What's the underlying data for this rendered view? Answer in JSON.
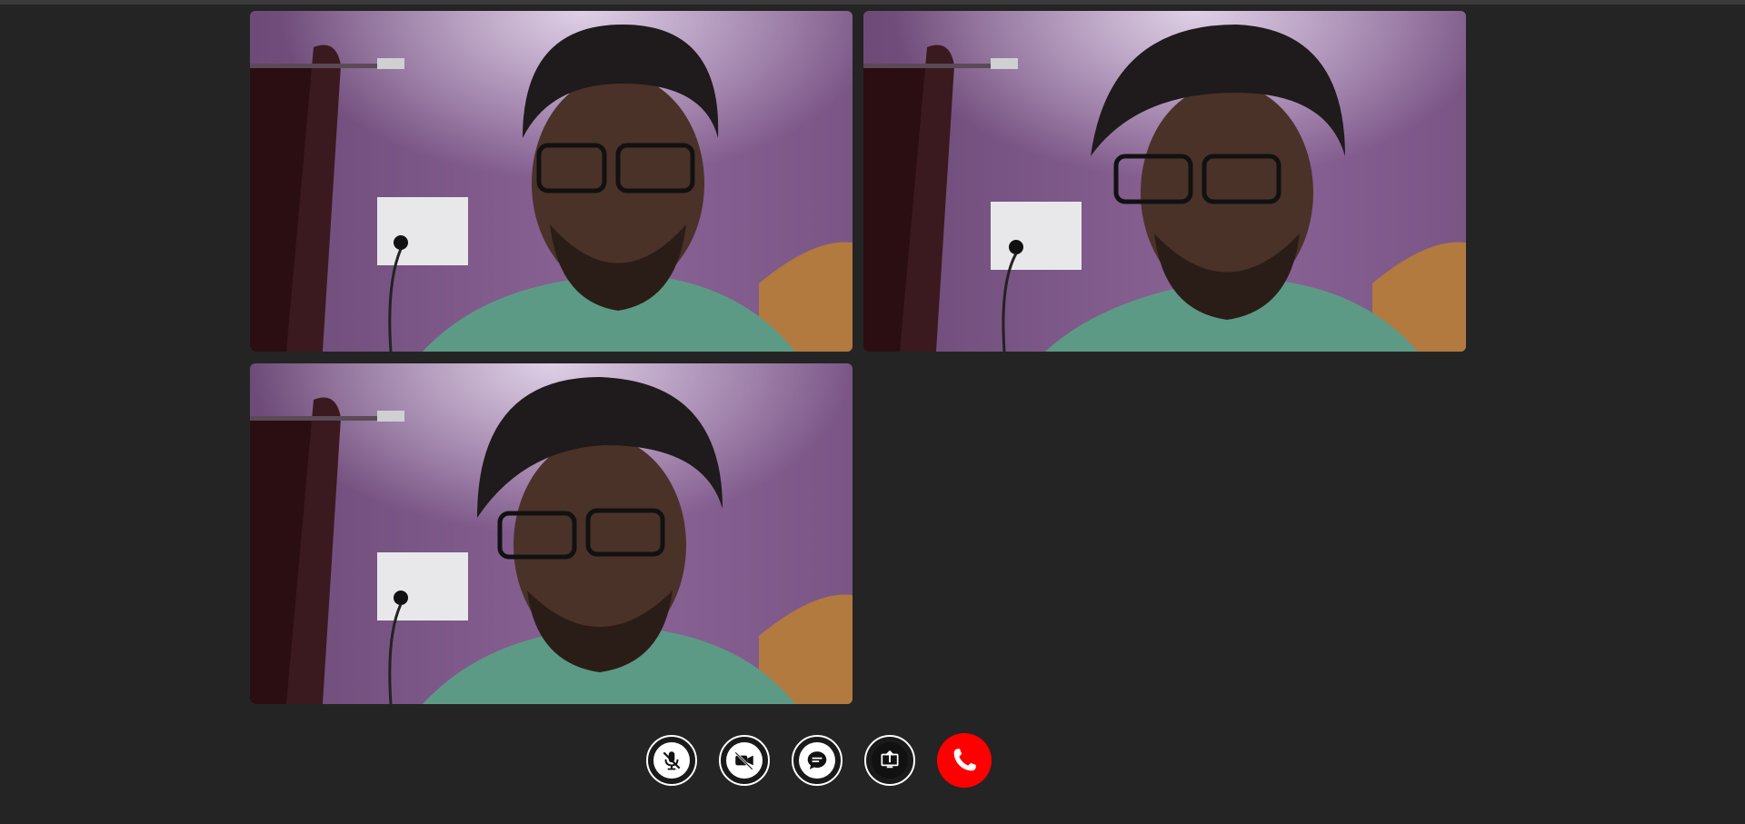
{
  "participants": [
    {
      "id": "p1",
      "video_icon": "participant-video"
    },
    {
      "id": "p2",
      "video_icon": "participant-video"
    },
    {
      "id": "p3",
      "video_icon": "participant-video"
    }
  ],
  "controls": [
    {
      "id": "mute-mic",
      "icon": "mic-off-icon"
    },
    {
      "id": "toggle-camera",
      "icon": "camera-off-icon"
    },
    {
      "id": "chat",
      "icon": "chat-icon"
    },
    {
      "id": "share-screen",
      "icon": "screen-share-icon"
    },
    {
      "id": "end-call",
      "icon": "phone-end-icon"
    }
  ],
  "colors": {
    "background": "#242424",
    "end_call": "#ff0000",
    "button_ring": "#ffffff"
  }
}
